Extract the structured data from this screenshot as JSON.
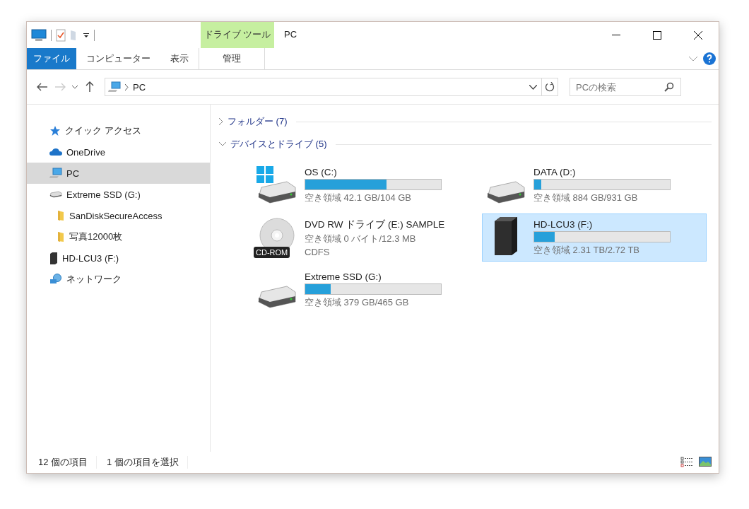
{
  "window": {
    "title": "PC"
  },
  "ribbon": {
    "context_group": "ドライブ ツール",
    "tabs": [
      {
        "label": "ファイル",
        "kind": "file",
        "selected": false
      },
      {
        "label": "コンピューター",
        "kind": "tab",
        "selected": false
      },
      {
        "label": "表示",
        "kind": "tab",
        "selected": false
      },
      {
        "label": "管理",
        "kind": "context",
        "selected": false
      }
    ]
  },
  "address_bar": {
    "path": "PC"
  },
  "search": {
    "placeholder": "PCの検索"
  },
  "navigation": [
    {
      "label": "クイック アクセス",
      "kind": "star",
      "selected": false
    },
    {
      "label": "OneDrive",
      "kind": "cloud",
      "selected": false
    },
    {
      "label": "PC",
      "kind": "pc",
      "selected": true
    },
    {
      "label": "Extreme SSD (G:)",
      "kind": "disk",
      "selected": false,
      "children": [
        {
          "label": "SanDiskSecureAccess",
          "kind": "folder",
          "selected": false
        },
        {
          "label": "写真12000枚",
          "kind": "folder",
          "selected": false
        }
      ]
    },
    {
      "label": "HD-LCU3 (F:)",
      "kind": "external",
      "selected": false
    },
    {
      "label": "ネットワーク",
      "kind": "network",
      "selected": false
    }
  ],
  "sections": [
    {
      "label": "フォルダー (7)",
      "expanded": false
    },
    {
      "label": "デバイスとドライブ (5)",
      "expanded": true,
      "drives": [
        {
          "name": "OS (C:)",
          "kind": "system",
          "level": 0.6,
          "detail": "空き領域 42.1 GB/104 GB",
          "selected": false
        },
        {
          "name": "DATA (D:)",
          "kind": "disk",
          "level": 0.05,
          "detail": "空き領域 884 GB/931 GB",
          "selected": false
        },
        {
          "name": "DVD RW ドライブ (E:) SAMPLE",
          "kind": "optical",
          "badge": "CD-ROM",
          "detail": "空き領域 0 バイト/12.3 MB",
          "filesystem": "CDFS",
          "selected": false
        },
        {
          "name": "HD-LCU3 (F:)",
          "kind": "external",
          "level": 0.15,
          "detail": "空き領域 2.31 TB/2.72 TB",
          "selected": true
        },
        {
          "name": "Extreme SSD (G:)",
          "kind": "disk",
          "level": 0.19,
          "detail": "空き領域 379 GB/465 GB",
          "selected": false
        }
      ]
    }
  ],
  "status_bar": {
    "item_count": "12 個の項目",
    "selection": "1 個の項目を選択"
  }
}
